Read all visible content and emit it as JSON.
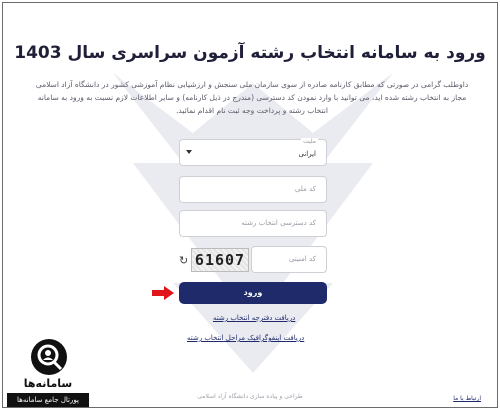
{
  "page": {
    "title": "ورود به سامانه انتخاب رشته آزمون سراسری سال 1403",
    "description": "داوطلب گرامی در صورتی که مطابق کارنامه صادره از سوی سازمان ملی سنجش و ارزشیابی نظام آموزشی کشور در دانشگاه آزاد اسلامی مجاز به انتخاب رشته شده اید، می توانید با وارد نمودن کد دسترسی (مندرج در ذیل کارنامه) و سایر اطلاعات لازم نسبت به ورود به سامانه انتخاب رشته و پرداخت وجه ثبت نام اقدام نمائید."
  },
  "form": {
    "nationality_caption": "ملیت",
    "nationality_value": "ایرانی",
    "national_code_placeholder": "کد ملی",
    "access_code_placeholder": "کد دسترسی انتخاب رشته",
    "captcha_placeholder": "کد امنیتی",
    "captcha_text": "61607",
    "submit_label": "ورود"
  },
  "links": {
    "booklet": "دریافت دفترچه انتخاب رشته",
    "infographic": "دریافت اینفوگرافیک مراحل انتخاب رشته",
    "contact": "ارتباط با ما"
  },
  "footer": {
    "text": "طراحی و پیاده سازی دانشگاه آزاد اسلامی"
  },
  "logo": {
    "name": "سامانه‌ها",
    "subtitle": "پورتال جامع سامانه‌ها"
  },
  "colors": {
    "primary": "#1f2a6b",
    "arrow": "#e0141b",
    "title": "#1f1f3a"
  },
  "icons": {
    "refresh": "refresh-icon",
    "arrow": "arrow-right-icon",
    "logo": "magnifier-person-icon"
  }
}
